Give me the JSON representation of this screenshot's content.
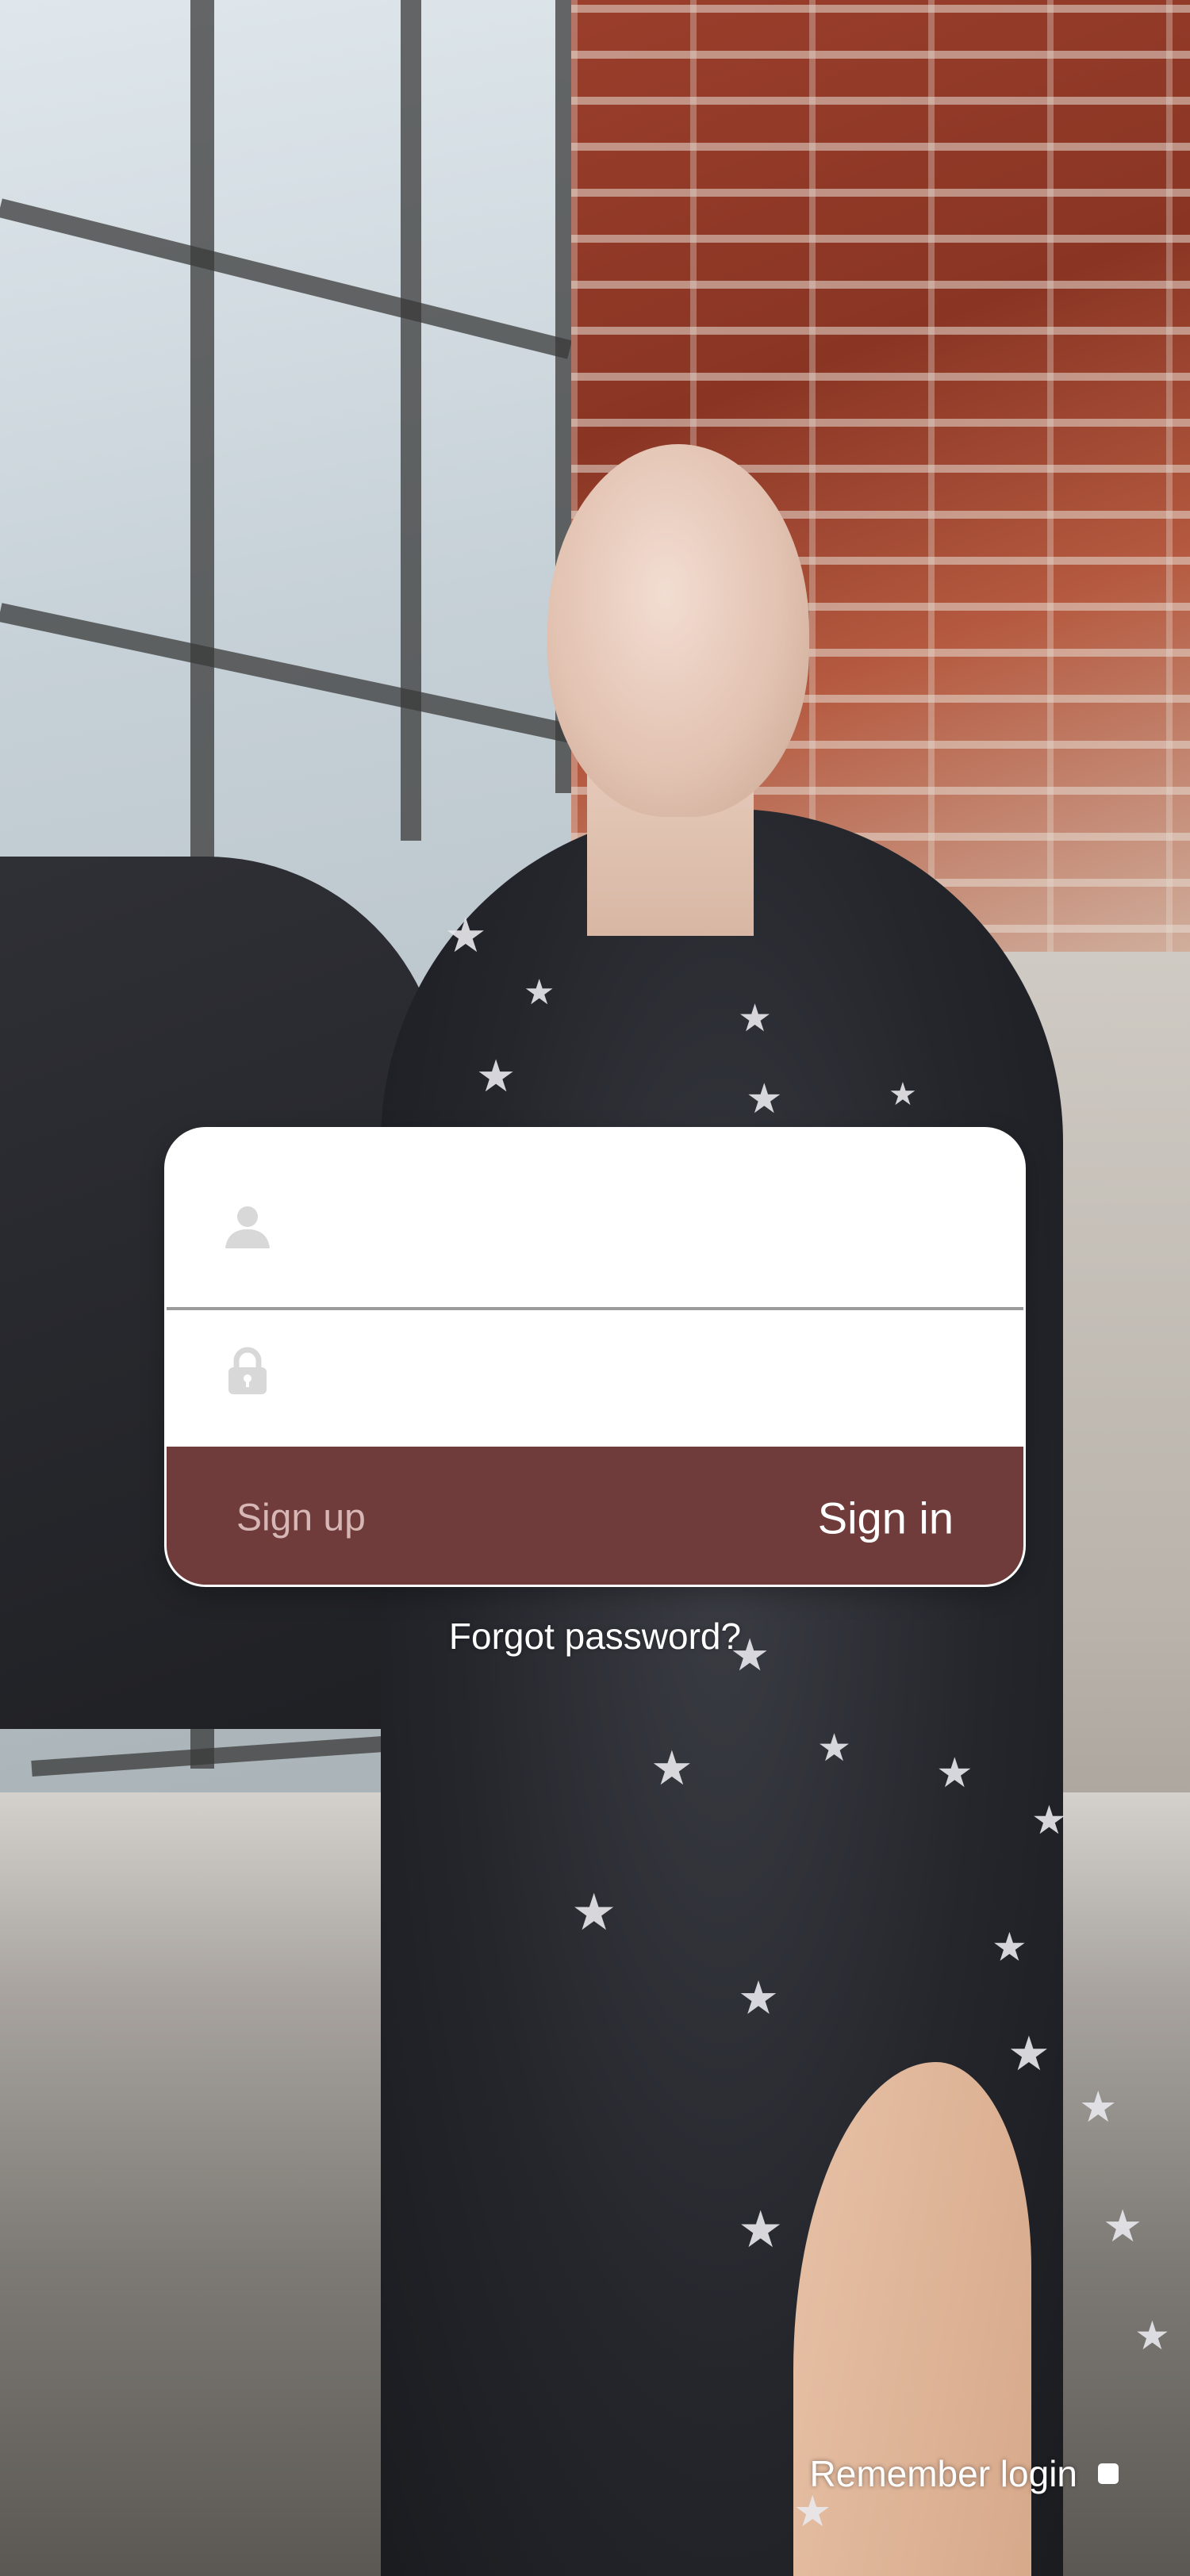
{
  "login": {
    "username_placeholder": "",
    "password_placeholder": "",
    "signup_label": "Sign up",
    "signin_label": "Sign in"
  },
  "forgot_password_label": "Forgot password?",
  "remember": {
    "label": "Remember login",
    "checked": false
  },
  "icons": {
    "username": "user-icon",
    "password": "lock-icon"
  },
  "colors": {
    "action_bar": "#6f3c3b",
    "signup_text": "#d6b7b5",
    "signin_text": "#ffffff",
    "icon_gray": "#d8d8d8",
    "divider": "#9b9b9b"
  }
}
